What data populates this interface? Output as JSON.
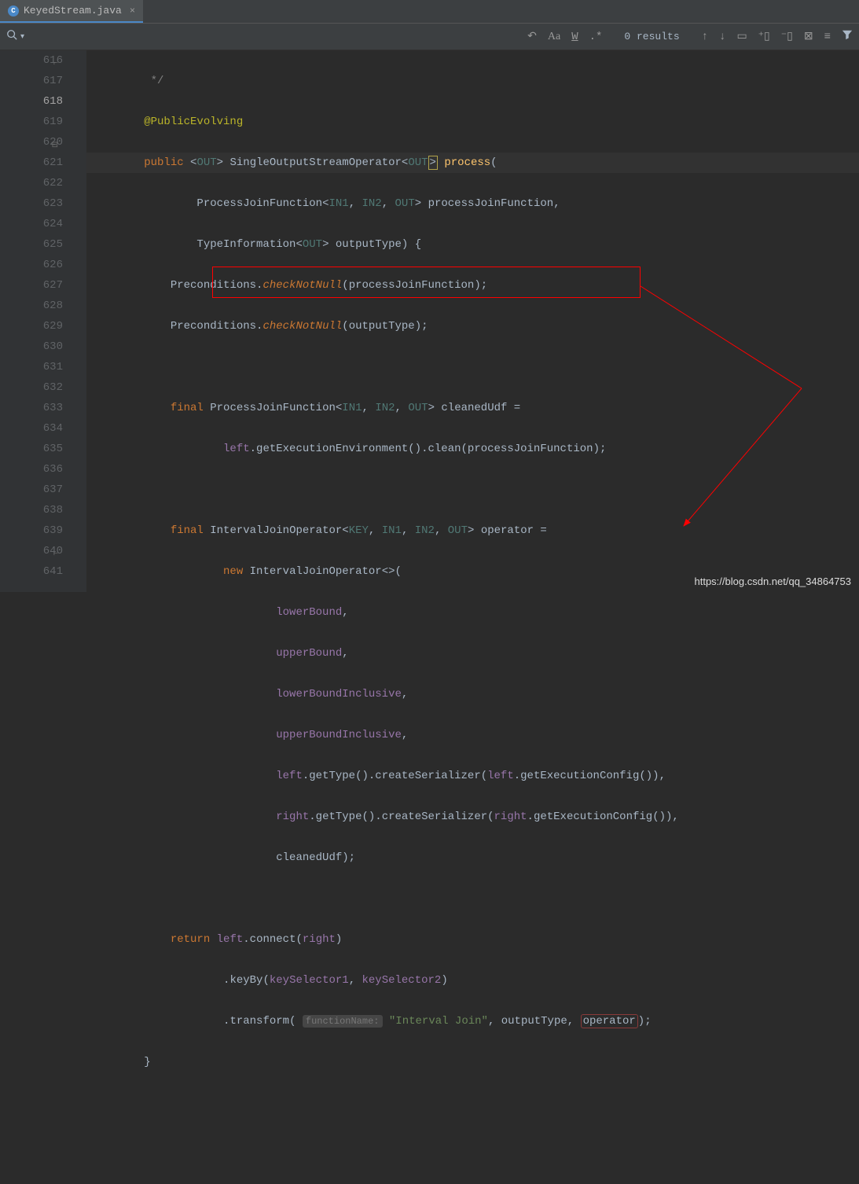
{
  "tab": {
    "filename": "KeyedStream.java"
  },
  "toolbar": {
    "results": "0 results"
  },
  "gutter": {
    "start": 616,
    "lines": [
      "616",
      "617",
      "618",
      "619",
      "620",
      "621",
      "622",
      "623",
      "624",
      "625",
      "626",
      "627",
      "628",
      "629",
      "630",
      "631",
      "632",
      "633",
      "634",
      "635",
      "636",
      "637",
      "638",
      "639",
      "640",
      "641"
    ]
  },
  "code": {
    "l616": "*/",
    "l617_anno": "@PublicEvolving",
    "l618_public": "public",
    "l618_out": "OUT",
    "l618_class": "SingleOutputStreamOperator",
    "l618_method": "process",
    "l619_pjf": "ProcessJoinFunction",
    "l619_in1": "IN1",
    "l619_in2": "IN2",
    "l619_out": "OUT",
    "l619_param": "processJoinFunction",
    "l620_ti": "TypeInformation",
    "l620_out": "OUT",
    "l620_param": "outputType",
    "l621_pre": "Preconditions",
    "l621_check": "checkNotNull",
    "l621_arg": "processJoinFunction",
    "l622_pre": "Preconditions",
    "l622_check": "checkNotNull",
    "l622_arg": "outputType",
    "l624_final": "final",
    "l624_pjf": "ProcessJoinFunction",
    "l624_in1": "IN1",
    "l624_in2": "IN2",
    "l624_out": "OUT",
    "l624_var": "cleanedUdf",
    "l625_left": "left",
    "l625_gee": "getExecutionEnvironment",
    "l625_clean": "clean",
    "l625_arg": "processJoinFunction",
    "l627_final": "final",
    "l627_ijo": "IntervalJoinOperator",
    "l627_key": "KEY",
    "l627_in1": "IN1",
    "l627_in2": "IN2",
    "l627_out": "OUT",
    "l627_op": "operator",
    "l628_new": "new",
    "l628_ijo": "IntervalJoinOperator",
    "l629_lb": "lowerBound",
    "l630_ub": "upperBound",
    "l631_lbi": "lowerBoundInclusive",
    "l632_ubi": "upperBoundInclusive",
    "l633_left": "left",
    "l633_gt": "getType",
    "l633_cs": "createSerializer",
    "l633_left2": "left",
    "l633_gec": "getExecutionConfig",
    "l634_right": "right",
    "l634_gt": "getType",
    "l634_cs": "createSerializer",
    "l634_right2": "right",
    "l634_gec": "getExecutionConfig",
    "l635_cu": "cleanedUdf",
    "l637_return": "return",
    "l637_left": "left",
    "l637_connect": "connect",
    "l637_right": "right",
    "l638_keyby": "keyBy",
    "l638_ks1": "keySelector1",
    "l638_ks2": "keySelector2",
    "l639_transform": "transform",
    "l639_hint": "functionName:",
    "l639_str": "\"Interval Join\"",
    "l639_ot": "outputType",
    "l639_op": "operator"
  },
  "watermark": "https://blog.csdn.net/qq_34864753"
}
